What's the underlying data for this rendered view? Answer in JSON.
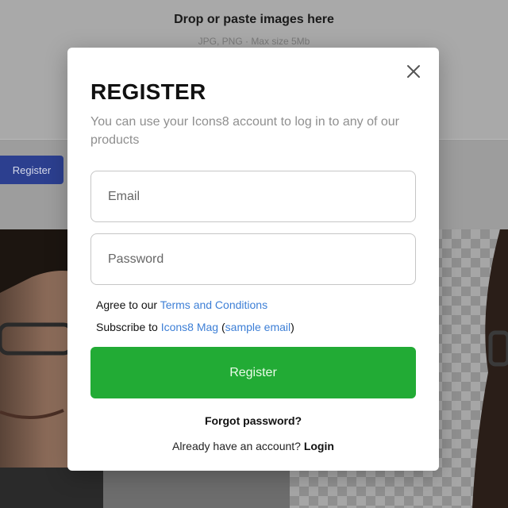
{
  "background": {
    "drop_title": "Drop or paste images here",
    "drop_subtitle": "JPG, PNG · Max size 5Mb",
    "register_button": "Register"
  },
  "modal": {
    "title": "REGISTER",
    "subtitle": "You can use your Icons8 account to log in to any of our products",
    "email_placeholder": "Email",
    "password_placeholder": "Password",
    "agree_prefix": "Agree to our ",
    "terms_link": "Terms and Conditions",
    "subscribe_prefix": "Subscribe to ",
    "mag_link": "Icons8 Mag",
    "open_paren": " (",
    "sample_link": "sample email",
    "close_paren": ")",
    "register_button": "Register",
    "forgot_password": "Forgot password?",
    "already_prefix": "Already have an account? ",
    "login_link": "Login",
    "close_icon": "close-icon"
  },
  "colors": {
    "accent_green": "#22ab35",
    "link_blue": "#3d7fd6",
    "bg_register_blue": "#2c3f8f"
  }
}
